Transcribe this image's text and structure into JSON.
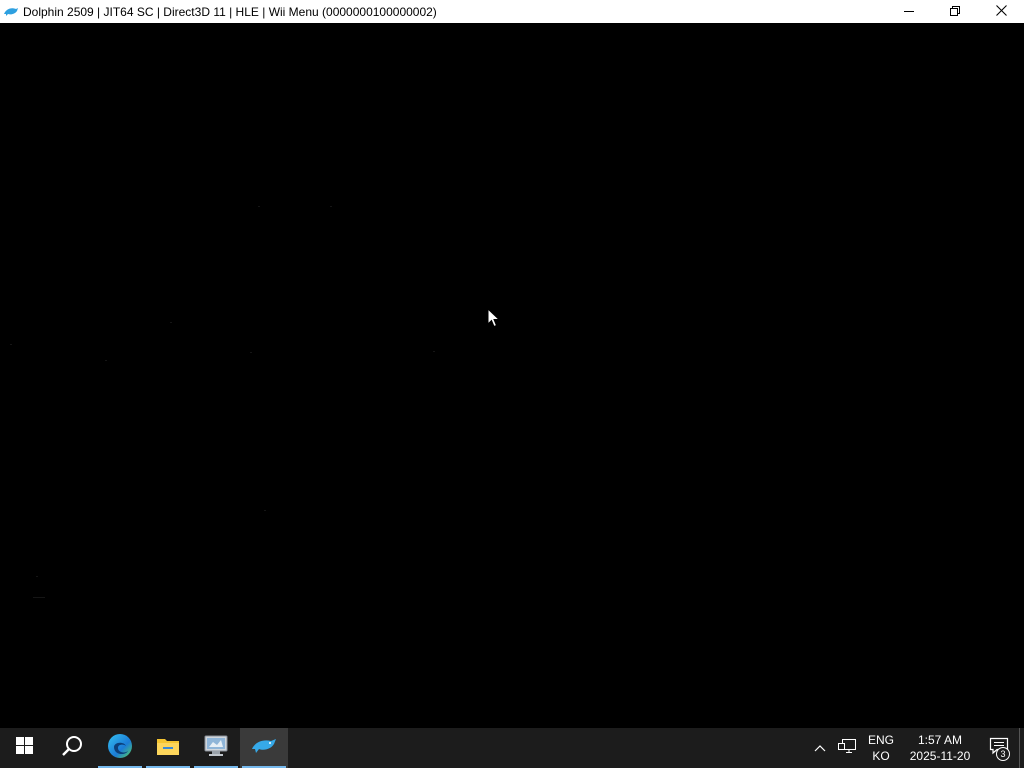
{
  "window": {
    "title": "Dolphin 2509 | JIT64 SC | Direct3D 11 | HLE | Wii Menu (0000000100000002)",
    "icon": "dolphin-icon",
    "controls": {
      "minimize_icon": "minimize-icon",
      "restore_icon": "restore-icon",
      "close_icon": "close-icon"
    }
  },
  "render_area": {
    "background": "#000000"
  },
  "taskbar": {
    "items": [
      {
        "name": "start",
        "icon": "windows-logo-icon"
      },
      {
        "name": "search",
        "icon": "search-icon"
      },
      {
        "name": "edge",
        "icon": "edge-icon",
        "running": true
      },
      {
        "name": "file-explorer",
        "icon": "folder-icon",
        "running": true
      },
      {
        "name": "network-app",
        "icon": "computer-icon",
        "running": true
      },
      {
        "name": "dolphin",
        "icon": "dolphin-icon",
        "running": true,
        "active": true
      }
    ],
    "tray": {
      "chevron_icon": "chevron-up-icon",
      "network_icon": "network-icon",
      "lang_line1": "ENG",
      "lang_line2": "KO",
      "time": "1:57 AM",
      "date": "2025-11-20",
      "notification_icon": "notification-icon",
      "notification_count": "3"
    },
    "accent_color": "#76b9ed"
  }
}
